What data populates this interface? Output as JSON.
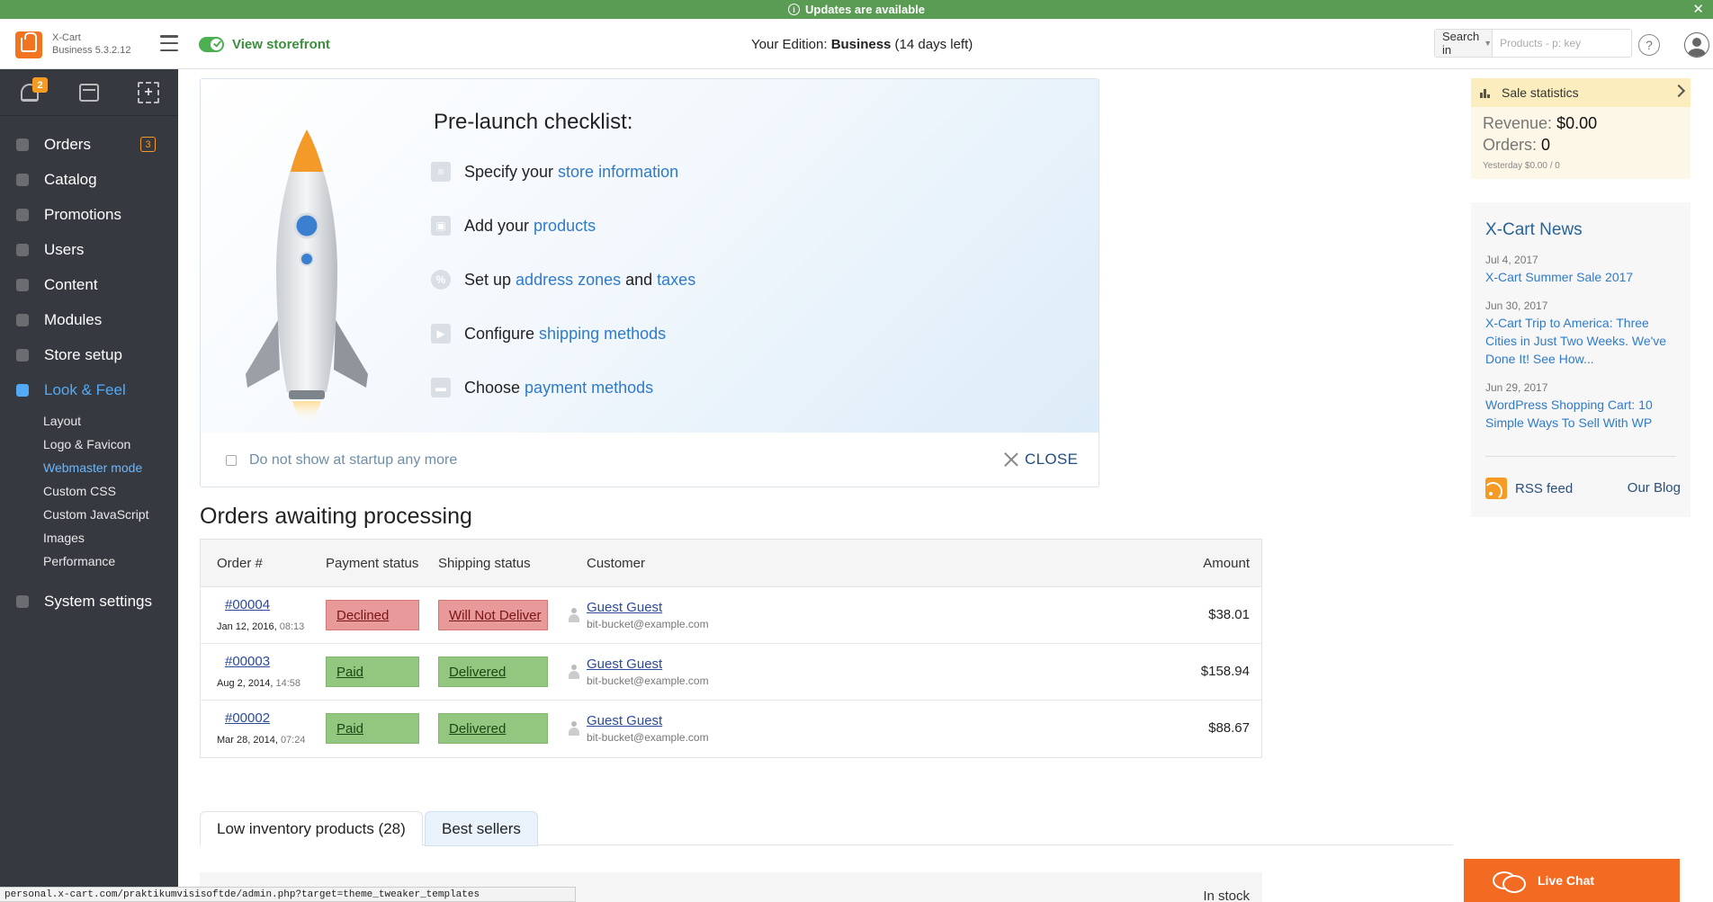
{
  "banner": {
    "text": "Updates are available",
    "close": "✕"
  },
  "header": {
    "app_name": "X-Cart",
    "app_version": "Business 5.3.2.12",
    "view_storefront": "View storefront",
    "edition_prefix": "Your Edition: ",
    "edition_name": "Business",
    "edition_suffix": " (14 days left)",
    "search_in": "Search in",
    "search_placeholder": "Products - p: key",
    "help": "?"
  },
  "sidebar": {
    "notifications_count": "2",
    "items": [
      {
        "label": "Orders",
        "badge": "3"
      },
      {
        "label": "Catalog"
      },
      {
        "label": "Promotions"
      },
      {
        "label": "Users"
      },
      {
        "label": "Content"
      },
      {
        "label": "Modules"
      },
      {
        "label": "Store setup"
      },
      {
        "label": "Look & Feel"
      }
    ],
    "subitems": [
      "Layout",
      "Logo & Favicon",
      "Webmaster mode",
      "Custom CSS",
      "Custom JavaScript",
      "Images",
      "Performance"
    ],
    "system_settings": "System settings"
  },
  "checklist": {
    "title": "Pre-launch checklist:",
    "row1_text": "Specify your",
    "row1_link": "store information",
    "row2_text": "Add your",
    "row2_link": "products",
    "row3_text": "Set up",
    "row3_link1": "address zones",
    "row3_and": "and",
    "row3_link2": "taxes",
    "row4_text": "Configure",
    "row4_link": "shipping methods",
    "row5_text": "Choose",
    "row5_link": "payment methods",
    "dont_show": "Do not show at startup any more",
    "close": "CLOSE"
  },
  "orders": {
    "title": "Orders awaiting processing",
    "columns": [
      "Order #",
      "Payment status",
      "Shipping status",
      "Customer",
      "Amount"
    ],
    "rows": [
      {
        "num": "#00004",
        "date": "Jan 12, 2016,",
        "time": "08:13",
        "payment": "Declined",
        "shipping": "Will Not Deliver",
        "customer": "Guest Guest",
        "email": "bit-bucket@example.com",
        "amount": "$38.01"
      },
      {
        "num": "#00003",
        "date": "Aug 2, 2014,",
        "time": "14:58",
        "payment": "Paid",
        "shipping": "Delivered",
        "customer": "Guest Guest",
        "email": "bit-bucket@example.com",
        "amount": "$158.94"
      },
      {
        "num": "#00002",
        "date": "Mar 28, 2014,",
        "time": "07:24",
        "payment": "Paid",
        "shipping": "Delivered",
        "customer": "Guest Guest",
        "email": "bit-bucket@example.com",
        "amount": "$88.67"
      }
    ]
  },
  "tabs": {
    "low_inventory": "Low inventory products (28)",
    "best_sellers": "Best sellers",
    "in_stock": "In stock"
  },
  "sale_stats": {
    "title": "Sale statistics",
    "revenue_label": "Revenue:",
    "revenue_value": "$0.00",
    "orders_label": "Orders:",
    "orders_value": "0",
    "yesterday": "Yesterday $0.00 / 0"
  },
  "news": {
    "title": "X-Cart News",
    "items": [
      {
        "date": "Jul 4, 2017",
        "title": "X-Cart Summer Sale 2017"
      },
      {
        "date": "Jun 30, 2017",
        "title": "X-Cart Trip to America: Three Cities in Just Two Weeks. We've Done It! See How..."
      },
      {
        "date": "Jun 29, 2017",
        "title": "WordPress Shopping Cart: 10 Simple Ways To Sell With WP"
      }
    ],
    "rss": "RSS feed",
    "blog": "Our Blog"
  },
  "live_chat": "Live Chat",
  "status_bar_url": "personal.x-cart.com/praktikumvisisoftde/admin.php?target=theme_tweaker_templates",
  "colors": {
    "banner": "#5a9c53",
    "sidebar": "#363940",
    "accent_orange": "#f27420",
    "link": "#2f7bc9"
  }
}
